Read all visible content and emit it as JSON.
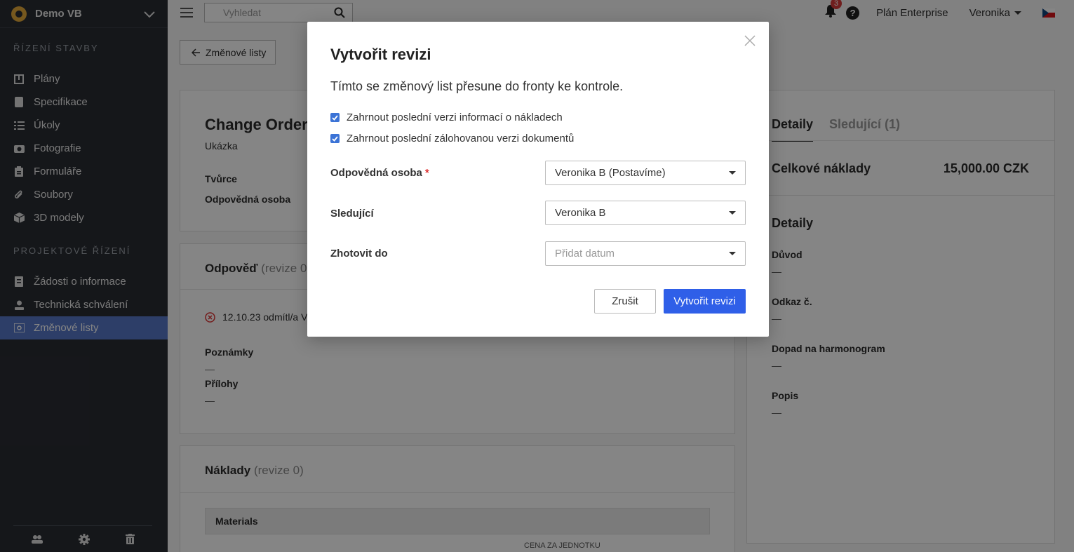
{
  "sidebar": {
    "project": "Demo VB",
    "section1": "ŘÍZENÍ STAVBY",
    "items1": [
      {
        "label": "Plány",
        "icon": "plans-icon"
      },
      {
        "label": "Specifikace",
        "icon": "specs-icon"
      },
      {
        "label": "Úkoly",
        "icon": "tasks-icon"
      },
      {
        "label": "Fotografie",
        "icon": "camera-icon"
      },
      {
        "label": "Formuláře",
        "icon": "clipboard-icon"
      },
      {
        "label": "Soubory",
        "icon": "paperclip-icon"
      },
      {
        "label": "3D modely",
        "icon": "cube-icon"
      }
    ],
    "section2": "PROJEKTOVÉ ŘÍZENÍ",
    "items2": [
      {
        "label": "Žádosti o informace",
        "icon": "document-icon"
      },
      {
        "label": "Technická schválení",
        "icon": "user-icon"
      },
      {
        "label": "Změnové listy",
        "icon": "change-orders-icon"
      }
    ]
  },
  "topbar": {
    "search_placeholder": "Vyhledat",
    "notif_count": "3",
    "plan": "Plán Enterprise",
    "user": "Veronika"
  },
  "main": {
    "back_label": "Změnové listy",
    "title": "Change Order #",
    "subtitle": "Ukázka",
    "creator_label": "Tvůrce",
    "responsible_label": "Odpovědná osoba",
    "response_title": "Odpověď",
    "response_rev": "(revize 0",
    "rejected_text": "12.10.23 odmítl/a V",
    "notes_label": "Poznámky",
    "notes_value": "—",
    "attachments_label": "Přílohy",
    "attachments_value": "—",
    "costs_title": "Náklady",
    "costs_rev": "(revize 0)",
    "materials_label": "Materials",
    "col_unit_price": "CENA ZA JEDNOTKU"
  },
  "right_panel": {
    "tab_details": "Detaily",
    "tab_followers": "Sledující (1)",
    "total_label": "Celkové náklady",
    "total_value": "15,000.00 CZK",
    "details_title": "Detaily",
    "reason_label": "Důvod",
    "reason_value": "—",
    "ref_label": "Odkaz č.",
    "ref_value": "—",
    "schedule_label": "Dopad na harmonogram",
    "schedule_value": "—",
    "desc_label": "Popis",
    "desc_value": "—"
  },
  "modal": {
    "title": "Vytvořit revizi",
    "description": "Tímto se změnový list přesune do fronty ke kontrole.",
    "checkbox1": "Zahrnout poslední verzi informací o nákladech",
    "checkbox2": "Zahrnout poslední zálohovanou verzi dokumentů",
    "responsible_label": "Odpovědná osoba",
    "responsible_value": "Veronika B (Postavíme)",
    "followers_label": "Sledující",
    "followers_value": "Veronika B",
    "due_label": "Zhotovit do",
    "due_placeholder": "Přidat datum",
    "cancel": "Zrušit",
    "submit": "Vytvořit revizi"
  }
}
